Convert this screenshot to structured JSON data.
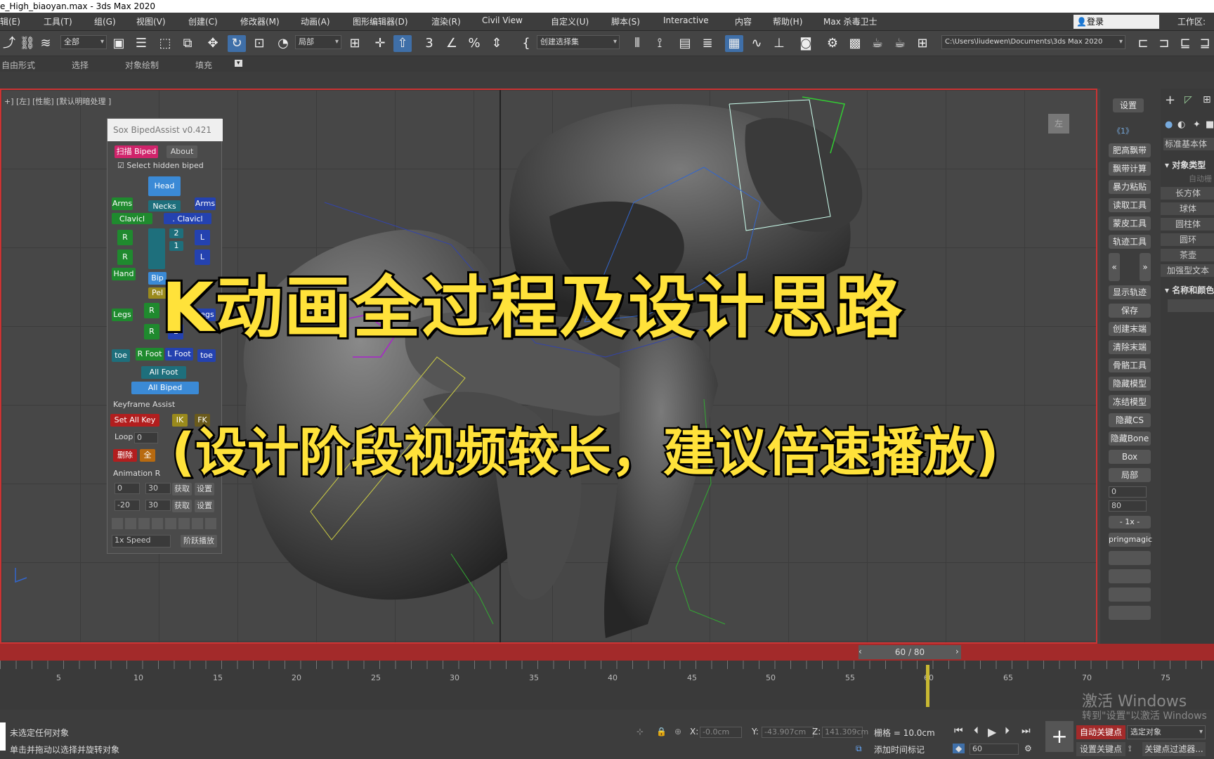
{
  "window": {
    "title": "e_High_biaoyan.max - 3ds Max 2020"
  },
  "menu": [
    "辑(E)",
    "工具(T)",
    "组(G)",
    "视图(V)",
    "创建(C)",
    "修改器(M)",
    "动画(A)",
    "图形编辑器(D)",
    "渲染(R)",
    "Civil View",
    "自定义(U)",
    "脚本(S)",
    "Interactive",
    "内容",
    "帮助(H)",
    "Max 杀毒卫士"
  ],
  "account": {
    "login": "登录",
    "workspace": "工作区:"
  },
  "toolbar": {
    "filter": "全部",
    "coord": "局部",
    "selection_set": "创建选择集",
    "path": "C:\\Users\\liudewen\\Documents\\3ds Max 2020"
  },
  "ribbon": [
    "自由形式",
    "选择",
    "对象绘制",
    "填充"
  ],
  "viewport": {
    "label": "+] [左] [性能] [默认明暗处理 ]",
    "cube": "左"
  },
  "overlay": {
    "title": "K动画全过程及设计思路",
    "subtitle": "(设计阶段视频较长，建议倍速播放)"
  },
  "sox": {
    "title": "Sox BipedAssist v0.421",
    "scan": "扫描 Biped",
    "about": "About",
    "hidden": "Select hidden biped",
    "head": "Head",
    "necks": "Necks",
    "arms_l": "Arms",
    "arms_r": "Arms",
    "clavicle_l": "Clavicl",
    "clavicle_r": ". Clavicl",
    "r": "R",
    "l": "L",
    "two": "2",
    "one": "1",
    "hand": "Hand",
    "bip": "Bip",
    "pel": "Pel",
    "legs_l": "Legs",
    "legs_r": "Legs",
    "toe_l": "toe",
    "toe_r": "toe",
    "r_foot": "R Foot",
    "l_foot": "L Foot",
    "all_foot": "All Foot",
    "all_biped": "All Biped",
    "keyframe": "Keyframe Assist",
    "set_all_key": "Set All Key",
    "ik": "IK",
    "fk": "FK",
    "loop": "Loop",
    "loop_val": "0",
    "delete": "删除",
    "all": "全",
    "anim_range": "Animation R",
    "r1a": "0",
    "r1b": "30",
    "get": "获取",
    "set": "设置",
    "r2a": "-20",
    "r2b": "30",
    "speed": "1x Speed",
    "play": "阶跃播放"
  },
  "cmd": {
    "settings": "设置",
    "page": "《1》",
    "buttons": [
      "肥高飘带",
      "飘带计算",
      "暴力粘贴",
      "读取工具",
      "蒙皮工具",
      "轨迹工具"
    ],
    "buttons2": [
      "显示轨迹",
      "保存",
      "创建末端",
      "清除末端",
      "骨骼工具",
      "隐藏模型",
      "冻结模型",
      "隐藏CS",
      "隐藏Bone",
      "Box",
      "局部"
    ],
    "spin1": "0",
    "spin2": "80",
    "speed": "- 1x -",
    "spring": "pringmagic",
    "create": {
      "category": "标准基本体",
      "object_type": "对象类型",
      "auto_grid": "自动栅",
      "items": [
        "长方体",
        "球体",
        "圆柱体",
        "圆环",
        "茶壶",
        "加强型文本"
      ],
      "name_color": "名称和颜色"
    }
  },
  "timeline": {
    "frame": "60 / 80",
    "ticks": [
      "5",
      "10",
      "15",
      "20",
      "25",
      "30",
      "35",
      "40",
      "45",
      "50",
      "55",
      "60",
      "65",
      "70",
      "75"
    ],
    "current": 60,
    "total": 80
  },
  "status": {
    "line1": "未选定任何对象",
    "line2": "单击并拖动以选择并旋转对象",
    "x_label": "X:",
    "x": "-0.0cm",
    "y_label": "Y:",
    "y": "-43.907cm",
    "z_label": "Z:",
    "z": "141.309cm",
    "grid": "栅格 = 10.0cm",
    "add_time_tag": "添加时间标记",
    "auto_key": "自动关键点",
    "selected": "选定对象",
    "set_key": "设置关键点",
    "key_filter": "关键点过滤器...",
    "frame_field": "60"
  },
  "windows": {
    "activate": "激活 Windows",
    "hint": "转到\"设置\"以激活 Windows"
  }
}
